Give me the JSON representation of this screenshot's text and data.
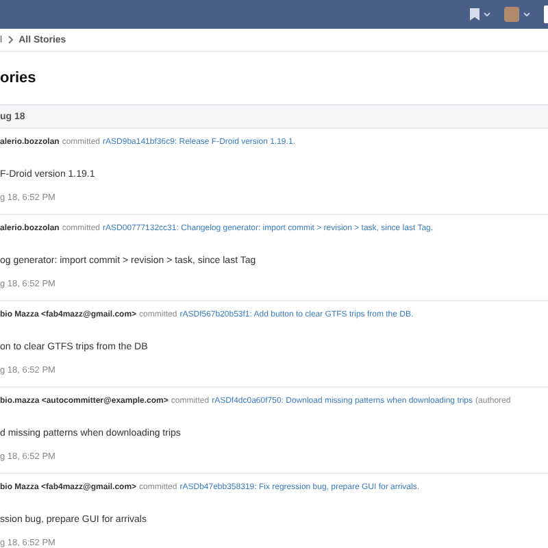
{
  "breadcrumb": [
    "l",
    "All Stories"
  ],
  "page_title": "ories",
  "date_header": "ug 18",
  "stories": [
    {
      "author": "alerio.bozzolan",
      "action": "committed",
      "link": "rASD9ba141bf36c9: Release F-Droid version 1.19.1.",
      "body": "F-Droid version 1.19.1",
      "time": "g 18, 6:52 PM"
    },
    {
      "author": "alerio.bozzolan",
      "action": "committed",
      "link": "rASD00777132cc31: Changelog generator: import commit > revision > task, since last Tag.",
      "body": "og generator: import commit > revision > task, since last Tag",
      "time": "g 18, 6:52 PM"
    },
    {
      "author": "bio Mazza <fab4mazz@gmail.com>",
      "action": "committed",
      "link": "rASDf567b20b53f1: Add button to clear GTFS trips from the DB.",
      "body": "on to clear GTFS trips from the DB",
      "time": "g 18, 6:52 PM"
    },
    {
      "author": "bio.mazza <autocommitter@example.com>",
      "action": "committed",
      "link": "rASDf4dc0a60f750: Download missing patterns when downloading trips",
      "suffix": "(authored",
      "body": "d missing patterns when downloading trips",
      "time": "g 18, 6:52 PM"
    },
    {
      "author": "bio Mazza <fab4mazz@gmail.com>",
      "action": "committed",
      "link": "rASDb47ebb358319: Fix regression bug, prepare GUI for arrivals.",
      "body": "ssion bug, prepare GUI for arrivals",
      "time": "g 18, 6:52 PM"
    }
  ]
}
